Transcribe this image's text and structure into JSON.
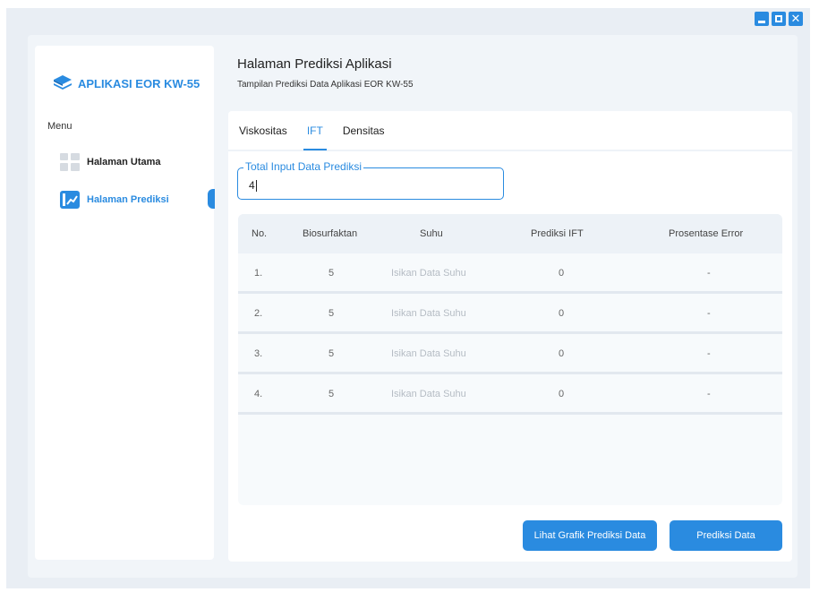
{
  "app": {
    "brand": "APLIKASI EOR KW-55",
    "colors": {
      "accent": "#2a8be0",
      "panel": "#f1f5f9"
    }
  },
  "window_controls": {
    "minimize": "minimize-icon",
    "maximize": "maximize-icon",
    "close": "close-icon"
  },
  "sidebar": {
    "menu_label": "Menu",
    "items": [
      {
        "label": "Halaman Utama",
        "icon": "grid-icon",
        "active": false
      },
      {
        "label": "Halaman Prediksi",
        "icon": "chart-icon",
        "active": true
      }
    ]
  },
  "header": {
    "title": "Halaman Prediksi Aplikasi",
    "subtitle": "Tampilan Prediksi Data Aplikasi EOR KW-55"
  },
  "tabs": [
    {
      "label": "Viskositas",
      "active": false
    },
    {
      "label": "IFT",
      "active": true
    },
    {
      "label": "Densitas",
      "active": false
    }
  ],
  "input": {
    "label": "Total Input Data Prediksi",
    "value": "4"
  },
  "table": {
    "columns": [
      "No.",
      "Biosurfaktan",
      "Suhu",
      "Prediksi IFT",
      "Prosentase Error"
    ],
    "rows": [
      [
        "1.",
        "5",
        "Isikan Data Suhu",
        "0",
        "-"
      ],
      [
        "2.",
        "5",
        "Isikan Data Suhu",
        "0",
        "-"
      ],
      [
        "3.",
        "5",
        "Isikan Data Suhu",
        "0",
        "-"
      ],
      [
        "4.",
        "5",
        "Isikan Data Suhu",
        "0",
        "-"
      ]
    ]
  },
  "buttons": {
    "chart": "Lihat Grafik Prediksi Data",
    "predict": "Prediksi Data"
  }
}
